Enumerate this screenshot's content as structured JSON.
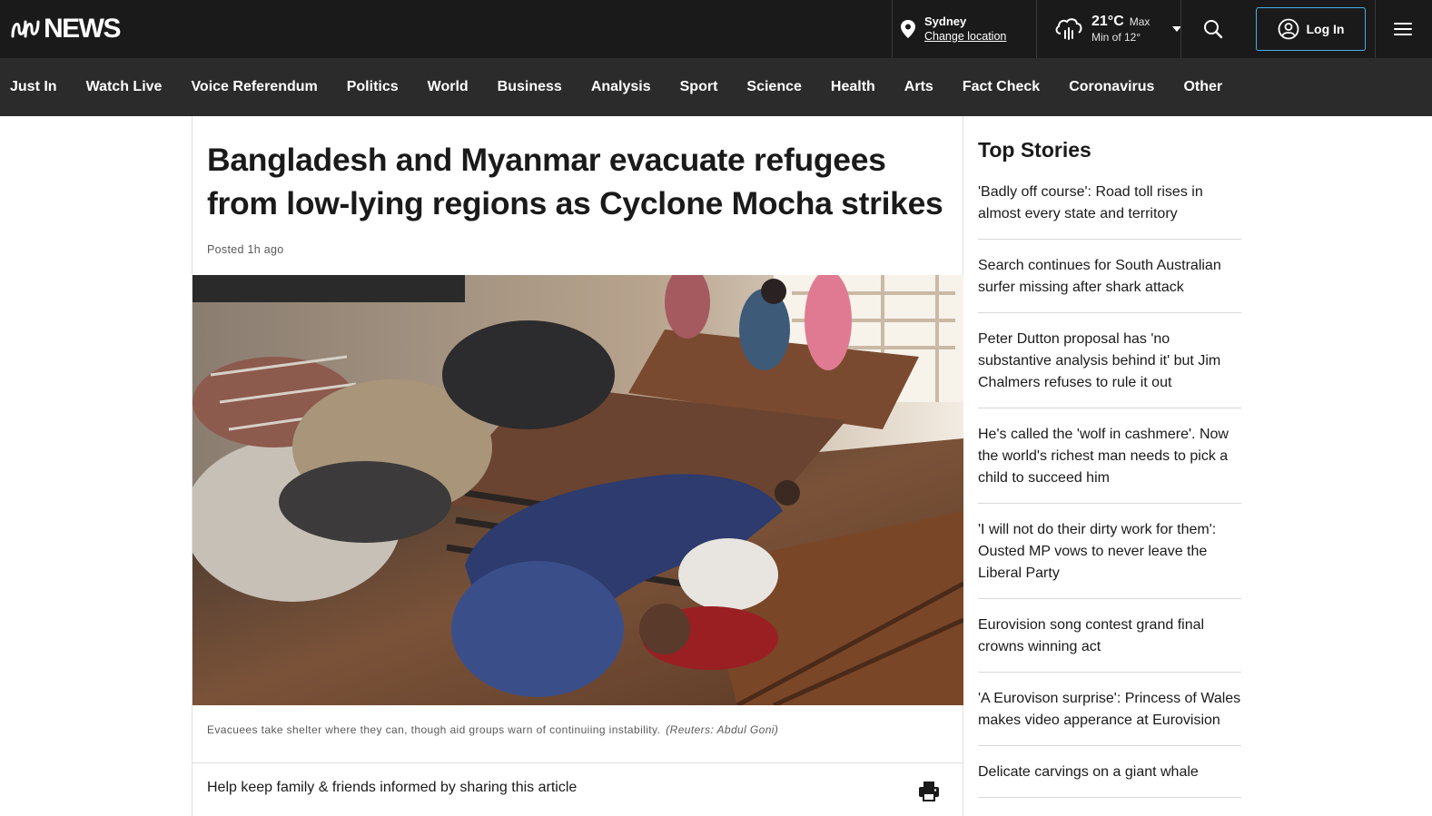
{
  "brand": {
    "name": "NEWS"
  },
  "location": {
    "city": "Sydney",
    "change_label": "Change location"
  },
  "weather": {
    "temp": "21°C",
    "max_label": "Max",
    "min_label": "Min of 12°"
  },
  "header": {
    "login_label": "Log In"
  },
  "nav": {
    "items": [
      "Just In",
      "Watch Live",
      "Voice Referendum",
      "Politics",
      "World",
      "Business",
      "Analysis",
      "Sport",
      "Science",
      "Health",
      "Arts",
      "Fact Check",
      "Coronavirus",
      "Other"
    ]
  },
  "article": {
    "headline": "Bangladesh and Myanmar evacuate refugees from low-lying regions as Cyclone Mocha strikes",
    "posted": "Posted 1h ago",
    "caption": "Evacuees take shelter where they can, though aid groups warn of continuiing instability.",
    "credit": "(Reuters: Abdul Goni)",
    "share_text": "Help keep family & friends informed by sharing this article"
  },
  "sidebar": {
    "title": "Top Stories",
    "stories": [
      "'Badly off course': Road toll rises in almost every state and territory",
      "Search continues for South Australian surfer missing after shark attack",
      "Peter Dutton proposal has 'no substantive analysis behind it' but Jim Chalmers refuses to rule it out",
      "He's called the 'wolf in cashmere'. Now the world's richest man needs to pick a child to succeed him",
      "'I will not do their dirty work for them': Ousted MP vows to never leave the Liberal Party",
      "Eurovision song contest grand final crowns winning act",
      "'A Eurovison surprise': Princess of Wales makes video apperance at Eurovision",
      "Delicate carvings on a giant whale"
    ]
  },
  "colors": {
    "topbar": "#1a1a1a",
    "navbar": "#2b2b2b",
    "login_border": "#4aaee6"
  }
}
